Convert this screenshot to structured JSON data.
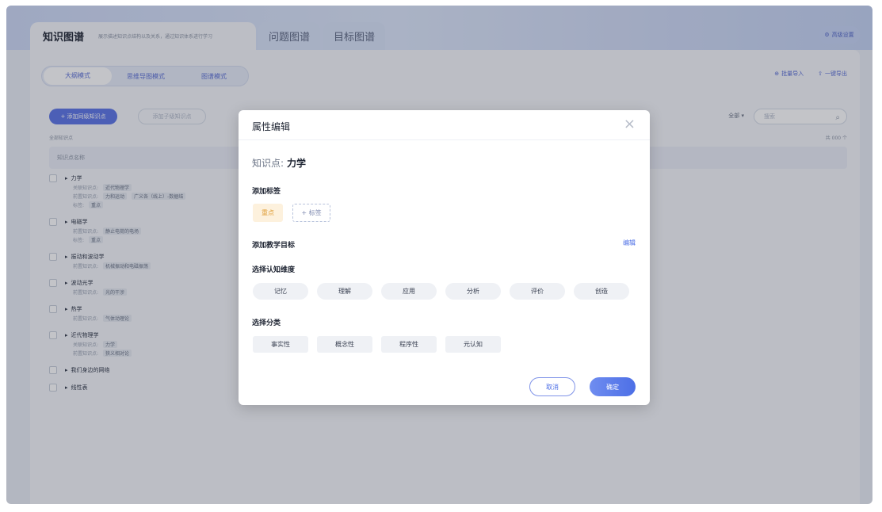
{
  "header": {
    "tabs": [
      {
        "label": "知识图谱",
        "desc": "展示描述知识点结构以及关系，通过知识体系进行学习"
      },
      {
        "label": "问题图谱"
      },
      {
        "label": "目标图谱"
      }
    ],
    "advanced_label": "高级设置"
  },
  "toolbar": {
    "modes": [
      "大纲模式",
      "思维导图模式",
      "图谱模式"
    ],
    "import_label": "批量导入",
    "export_label": "一键导出",
    "add_sibling_label": "+ 添加同级知识点",
    "add_child_label": "添加子级知识点",
    "filter_label": "全部 ▾",
    "search_placeholder": "搜索",
    "all_label": "全部知识点",
    "count_label": "共 000 个",
    "column_header": "知识点名称"
  },
  "tree": [
    {
      "name": "力学",
      "lines": [
        {
          "label": "关联知识点:",
          "chips": [
            "近代物理学"
          ]
        },
        {
          "label": "前置知识点:",
          "chips": [
            "力和运动",
            "广义各（线上）-数据结"
          ]
        },
        {
          "label": "标签:",
          "chips": [
            "重点"
          ]
        }
      ]
    },
    {
      "name": "电磁学",
      "lines": [
        {
          "label": "前置知识点:",
          "chips": [
            "静止电荷的电场"
          ]
        },
        {
          "label": "标签:",
          "chips": [
            "重点"
          ]
        }
      ]
    },
    {
      "name": "振动和波动学",
      "lines": [
        {
          "label": "前置知识点:",
          "chips": [
            "机械振动和电磁振荡"
          ]
        }
      ]
    },
    {
      "name": "波动光学",
      "lines": [
        {
          "label": "前置知识点:",
          "chips": [
            "光的干涉"
          ]
        }
      ]
    },
    {
      "name": "热学",
      "lines": [
        {
          "label": "前置知识点:",
          "chips": [
            "气体动理论"
          ]
        }
      ]
    },
    {
      "name": "近代物理学",
      "lines": [
        {
          "label": "关联知识点:",
          "chips": [
            "力学"
          ]
        },
        {
          "label": "前置知识点:",
          "chips": [
            "狭义相对论"
          ]
        }
      ]
    },
    {
      "name": "我们身边的网络",
      "lines": []
    },
    {
      "name": "线性表",
      "lines": []
    }
  ],
  "modal": {
    "title": "属性编辑",
    "close_icon": "×",
    "kp_label": "知识点:",
    "kp_value": "力学",
    "add_tag_title": "添加标签",
    "active_tag": "重点",
    "add_tag_button": "+ 标签",
    "teaching_goal_title": "添加教学目标",
    "edit_link": "编辑",
    "cognitive_title": "选择认知维度",
    "cognitive_options": [
      "记忆",
      "理解",
      "应用",
      "分析",
      "评价",
      "创造"
    ],
    "category_title": "选择分类",
    "category_options": [
      "事实性",
      "概念性",
      "程序性",
      "元认知"
    ],
    "cancel_label": "取消",
    "ok_label": "确定"
  }
}
